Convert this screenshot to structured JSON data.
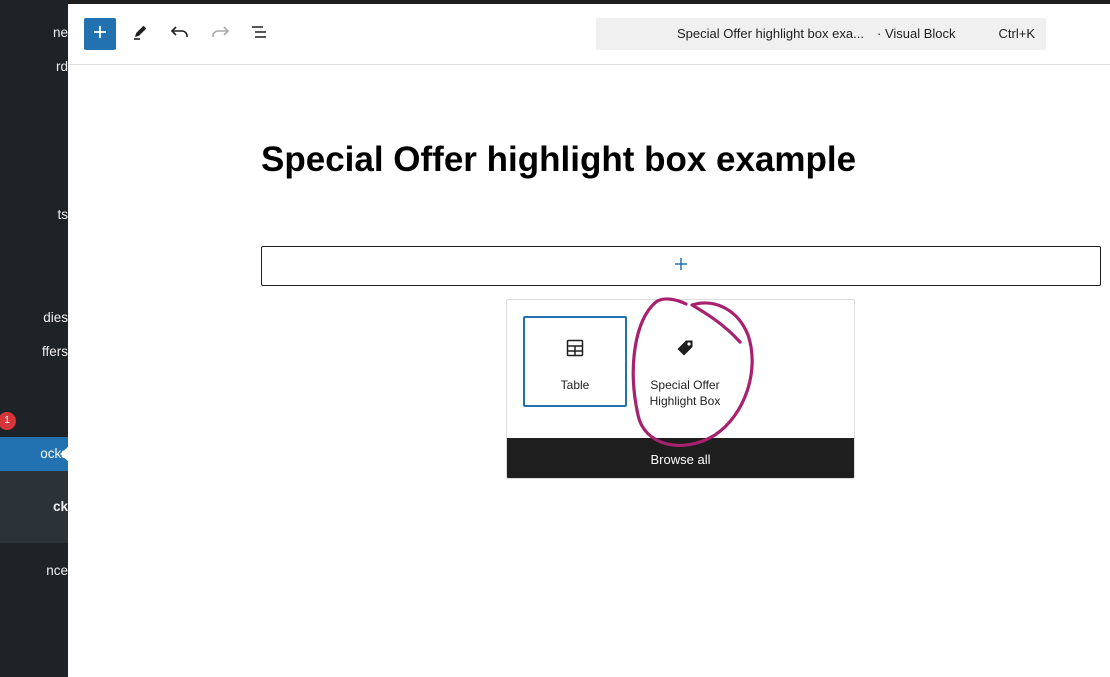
{
  "sidebar": {
    "items": [
      {
        "label": "ne"
      },
      {
        "label": "rd"
      },
      {
        "label": "ts"
      },
      {
        "label": "dies"
      },
      {
        "label": "ffers"
      },
      {
        "label": "ocks"
      },
      {
        "label": "ck"
      },
      {
        "label": "nce"
      }
    ],
    "badge_count": "1"
  },
  "toolbar": {
    "add_block_icon": "plus-icon",
    "tools_icon": "pencil-icon",
    "undo_icon": "undo-icon",
    "redo_icon": "redo-icon",
    "list_view_icon": "list-view-icon",
    "accent_color": "#2271b1"
  },
  "command_bar": {
    "title": "Special Offer highlight box exa...",
    "post_type": "· Visual Block",
    "shortcut": "Ctrl+K"
  },
  "editor": {
    "post_title": "Special Offer highlight box example"
  },
  "inserter": {
    "blocks": [
      {
        "label": "Table",
        "icon": "table-icon"
      },
      {
        "label": "Special Offer Highlight Box",
        "icon": "tag-icon"
      }
    ],
    "browse_all_label": "Browse all"
  },
  "annotation": {
    "color": "#a8216e",
    "shape": "hand-drawn circle"
  }
}
